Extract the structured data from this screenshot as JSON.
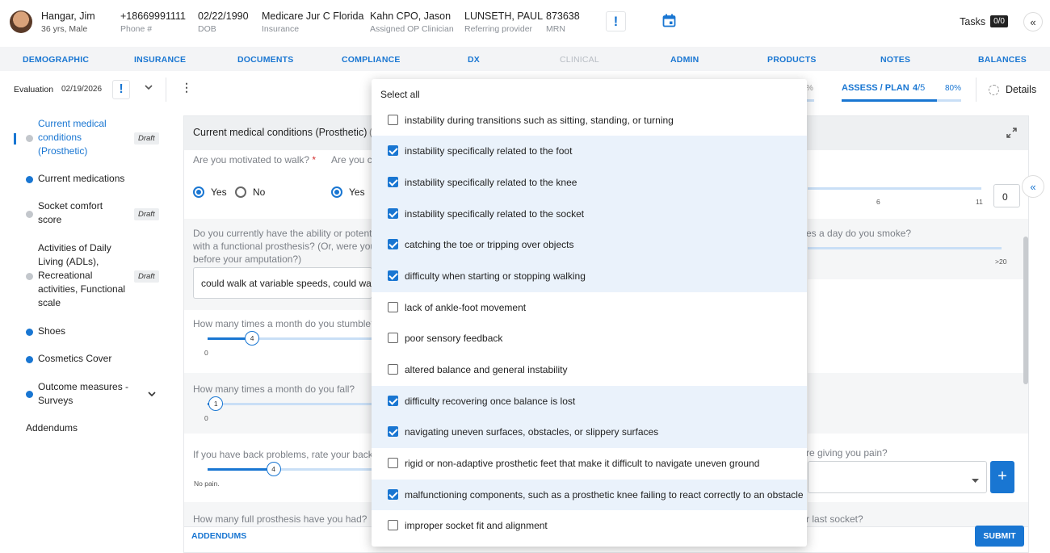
{
  "patient": {
    "name": "Hangar, Jim",
    "age_sex": "36 yrs, Male",
    "phone": "+18669991111",
    "phone_label": "Phone #",
    "dob": "02/22/1990",
    "dob_label": "DOB",
    "insurance": "Medicare Jur C Florida",
    "insurance_label": "Insurance",
    "clinician": "Kahn CPO, Jason",
    "clinician_label": "Assigned OP Clinician",
    "referring": "LUNSETH, PAUL",
    "referring_label": "Referring provider",
    "mrn": "873638",
    "mrn_label": "MRN"
  },
  "header": {
    "tasks_label": "Tasks",
    "tasks_count": "0/0",
    "alert_icon": "exclamation-icon",
    "calendar_icon": "calendar-icon",
    "collapse_icon": "double-chevron-left-icon"
  },
  "nav": [
    "DEMOGRAPHIC",
    "INSURANCE",
    "DOCUMENTS",
    "COMPLIANCE",
    "DX",
    "CLINICAL",
    "ADMIN",
    "PRODUCTS",
    "NOTES",
    "BALANCES"
  ],
  "evaluation": {
    "label": "Evaluation",
    "date": "02/19/2026",
    "assess_label": "ASSESS / PLAN",
    "assess_done": "4",
    "assess_total": "/5",
    "assess_pct": "80%",
    "assess_fraction": 0.8,
    "prev_pct": "%",
    "details_label": "Details"
  },
  "sidebar": [
    {
      "label": "Current medical conditions (Prosthetic)",
      "status": "Draft",
      "active": true
    },
    {
      "label": "Current medications",
      "status": ""
    },
    {
      "label": "Socket comfort score",
      "status": "Draft"
    },
    {
      "label": "Activities of Daily Living (ADLs), Recreational activities, Functional scale",
      "status": "Draft"
    },
    {
      "label": "Shoes",
      "status": ""
    },
    {
      "label": "Cosmetics Cover",
      "status": ""
    },
    {
      "label": "Outcome measures - Surveys",
      "status": ""
    },
    {
      "label": "Addendums",
      "status": ""
    }
  ],
  "section": {
    "title": "Current medical conditions (Prosthetic)",
    "title_suffix": "(",
    "q_motivated": "Are you motivated to walk?",
    "required": "*",
    "q_motivated2": "Are you c",
    "yes": "Yes",
    "no": "No",
    "q_ability_l1": "Do you currently have the ability or potenti",
    "q_ability_l2": "with a functional prosthesis? (Or, were you",
    "q_ability_l3": "before your amputation?)",
    "ability_value": "could walk at variable speeds, could walk",
    "q_stumble": "How many times a month do you stumble?",
    "stumble_value": "4",
    "stumble_fraction": 0.27,
    "stumble_min": "0",
    "q_fall": "How many times a month do you fall?",
    "fall_value": "1",
    "fall_fraction": 0.05,
    "fall_min": "0",
    "q_back": "If you have back problems, rate your back p",
    "back_value": "4",
    "back_fraction": 0.4,
    "back_min": "No pain.",
    "q_prosthesis": "How many full prosthesis have you had?",
    "right_tick_6": "6",
    "right_tick_11": "11",
    "right_value": "0",
    "q_smoke": "es a day do you smoke?",
    "smoke_max": ">20",
    "q_pain": "re giving you pain?",
    "q_socket": "r last socket?",
    "addendums_link": "ADDENDUMS",
    "submit": "SUBMIT"
  },
  "dropdown": {
    "select_all": "Select all",
    "options": [
      {
        "label": "instability during transitions such as sitting, standing, or turning",
        "checked": false
      },
      {
        "label": "instability specifically related to the foot",
        "checked": true
      },
      {
        "label": "instability specifically related to the knee",
        "checked": true
      },
      {
        "label": "instability specifically related to the socket",
        "checked": true
      },
      {
        "label": "catching the toe or tripping over objects",
        "checked": true
      },
      {
        "label": "difficulty when starting or stopping walking",
        "checked": true
      },
      {
        "label": "lack of ankle-foot movement",
        "checked": false
      },
      {
        "label": "poor sensory feedback",
        "checked": false
      },
      {
        "label": "altered balance and general instability",
        "checked": false
      },
      {
        "label": "difficulty recovering once balance is lost",
        "checked": true
      },
      {
        "label": "navigating uneven surfaces, obstacles, or slippery surfaces",
        "checked": true
      },
      {
        "label": "rigid or non-adaptive prosthetic feet that make it difficult to navigate uneven ground",
        "checked": false
      },
      {
        "label": "malfunctioning components, such as a prosthetic knee failing to react correctly to an obstacle",
        "checked": true
      },
      {
        "label": "improper socket fit and alignment",
        "checked": false
      }
    ]
  },
  "colors": {
    "accent": "#1976d2",
    "draft_bg": "#eceef0"
  }
}
